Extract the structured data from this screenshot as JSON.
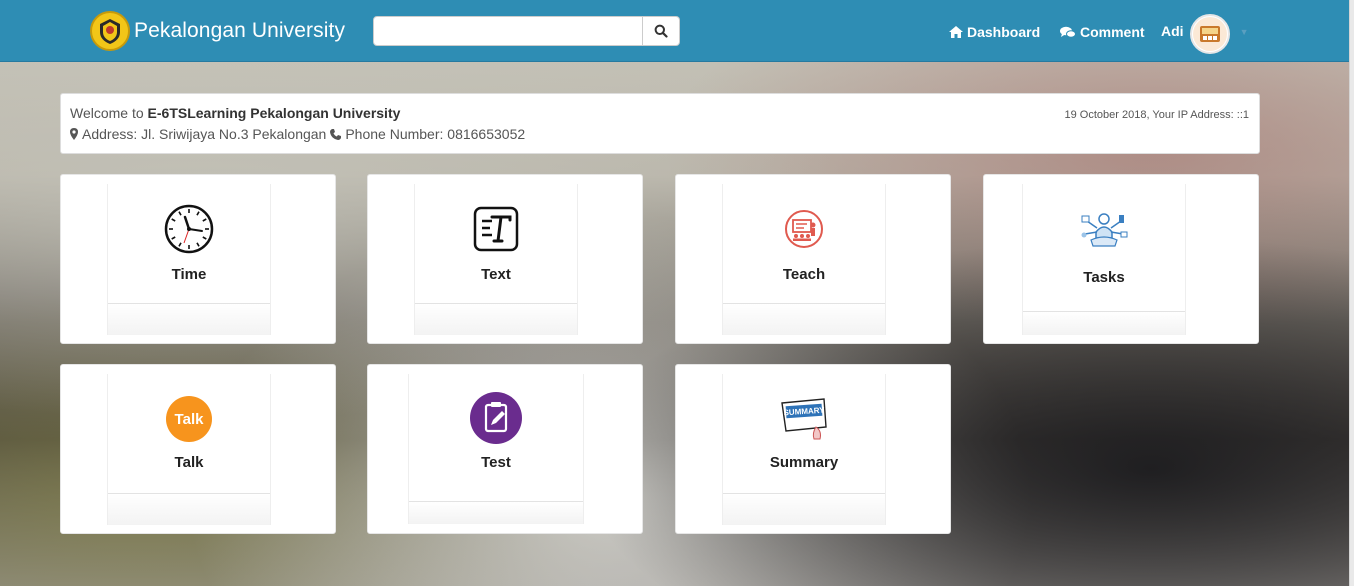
{
  "navbar": {
    "brand": "Pekalongan University",
    "search_placeholder": "",
    "links": {
      "dashboard": "Dashboard",
      "comment": "Comment"
    },
    "user": "Adi"
  },
  "welcome": {
    "prefix": "Welcome to ",
    "site": "E-6TSLearning Pekalongan University",
    "address_label": "Address: Jl. Sriwijaya No.3 Pekalongan",
    "phone_label": "Phone Number: 0816653052",
    "date_ip": "19 October 2018, Your IP Address: ::1"
  },
  "tiles": [
    {
      "label": "Time",
      "icon": "clock-icon"
    },
    {
      "label": "Text",
      "icon": "text-icon"
    },
    {
      "label": "Teach",
      "icon": "teach-icon"
    },
    {
      "label": "Tasks",
      "icon": "tasks-icon"
    },
    {
      "label": "Talk",
      "icon": "talk-icon"
    },
    {
      "label": "Test",
      "icon": "test-icon"
    },
    {
      "label": "Summary",
      "icon": "summary-icon"
    }
  ],
  "icons": {
    "talk_text": "Talk",
    "summary_text": "SUMMARY"
  },
  "colors": {
    "navbar": "#2e8db4",
    "talk": "#f7941d",
    "test": "#6a2c8e",
    "teach": "#e05a4f"
  }
}
